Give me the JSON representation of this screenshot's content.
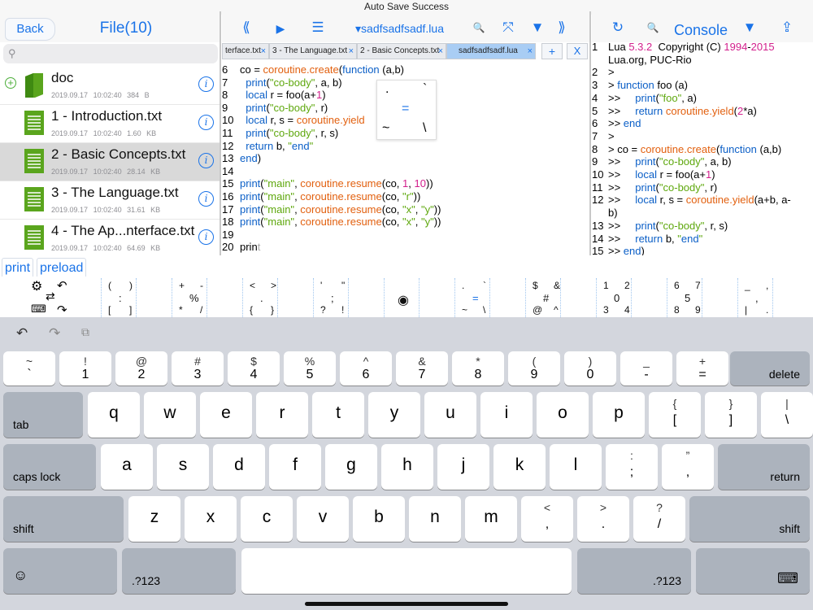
{
  "status": {
    "title": "Auto Save Success"
  },
  "files": {
    "back_label": "Back",
    "title": "File(10)",
    "search_placeholder": "",
    "items": [
      {
        "name": "doc",
        "date": "2019.09.17",
        "time": "10:02:40",
        "size": "384 B",
        "type": "folder"
      },
      {
        "name": "1 - Introduction.txt",
        "date": "2019.09.17",
        "time": "10:02:40",
        "size": "1.60 KB",
        "type": "file"
      },
      {
        "name": "2 - Basic Concepts.txt",
        "date": "2019.09.17",
        "time": "10:02:40",
        "size": "28.14 KB",
        "type": "file",
        "selected": true
      },
      {
        "name": "3 - The Language.txt",
        "date": "2019.09.17",
        "time": "10:02:40",
        "size": "31.61 KB",
        "type": "file"
      },
      {
        "name": "4 - The Ap...nterface.txt",
        "date": "2019.09.17",
        "time": "10:02:40",
        "size": "64.69 KB",
        "type": "file"
      }
    ],
    "info_glyph": "i"
  },
  "editor": {
    "toolbar": {
      "prev": "⟪",
      "run": "▶",
      "outline": "☰",
      "filename": "▾sadfsadfsadf.lua",
      "search": "🔍",
      "fullscreen": "⤧",
      "down": "▼",
      "next": "⟫"
    },
    "tabs": [
      {
        "label": "terface.txt"
      },
      {
        "label": "3 - The Language.txt"
      },
      {
        "label": "2 - Basic Concepts.txt"
      },
      {
        "label": "sadfsadfsadf.lua",
        "active": true
      }
    ],
    "tab_add": "+",
    "tab_close": "X",
    "tab_x": "×",
    "lines": [
      {
        "n": "6",
        "t": "co = coroutine.create(function (a,b)"
      },
      {
        "n": "7",
        "t": "  print(\"co-body\", a, b)"
      },
      {
        "n": "8",
        "t": "  local r = foo(a+1)"
      },
      {
        "n": "9",
        "t": "  print(\"co-body\", r)"
      },
      {
        "n": "10",
        "t": "  local r, s = coroutine.yield"
      },
      {
        "n": "11",
        "t": "  print(\"co-body\", r, s)"
      },
      {
        "n": "12",
        "t": "  return b, \"end\""
      },
      {
        "n": "13",
        "t": "end)"
      },
      {
        "n": "14",
        "t": ""
      },
      {
        "n": "15",
        "t": "print(\"main\", coroutine.resume(co, 1, 10))"
      },
      {
        "n": "16",
        "t": "print(\"main\", coroutine.resume(co, \"r\"))"
      },
      {
        "n": "17",
        "t": "print(\"main\", coroutine.resume(co, \"x\", \"y\"))"
      },
      {
        "n": "18",
        "t": "print(\"main\", coroutine.resume(co, \"x\", \"y\"))"
      },
      {
        "n": "19",
        "t": ""
      },
      {
        "n": "20",
        "t": "print"
      }
    ],
    "popup": {
      "tl": ".",
      "tr": "`",
      "c": "=",
      "bl": "~",
      "br": "\\"
    }
  },
  "console": {
    "refresh": "↻",
    "search": "🔍",
    "title": "Console",
    "down": "▼",
    "share": "⇪",
    "lines": [
      {
        "n": "1",
        "t": "Lua 5.3.2  Copyright (C) 1994-2015"
      },
      {
        "n": "",
        "t": "Lua.org, PUC-Rio"
      },
      {
        "n": "2",
        "t": ">"
      },
      {
        "n": "3",
        "t": "> function foo (a)"
      },
      {
        "n": "4",
        "t": ">>     print(\"foo\", a)"
      },
      {
        "n": "5",
        "t": ">>     return coroutine.yield(2*a)"
      },
      {
        "n": "6",
        "t": ">> end"
      },
      {
        "n": "7",
        "t": ">"
      },
      {
        "n": "8",
        "t": "> co = coroutine.create(function (a,b)"
      },
      {
        "n": "9",
        "t": ">>     print(\"co-body\", a, b)"
      },
      {
        "n": "10",
        "t": ">>     local r = foo(a+1)"
      },
      {
        "n": "11",
        "t": ">>     print(\"co-body\", r)"
      },
      {
        "n": "12",
        "t": ">>     local r, s = coroutine.yield(a+b, a-"
      },
      {
        "n": "",
        "t": "b)"
      },
      {
        "n": "13",
        "t": ">>     print(\"co-body\", r, s)"
      },
      {
        "n": "14",
        "t": ">>     return b, \"end\""
      },
      {
        "n": "15",
        "t": ">> end)"
      }
    ]
  },
  "quickbar": {
    "print": "print",
    "preload": "preload"
  },
  "symbols": [
    {
      "a": "(",
      "b": ")",
      "c": ":",
      "d": "[",
      "e": "]"
    },
    {
      "a": "+",
      "b": "-",
      "c": "%",
      "d": "*",
      "e": "/"
    },
    {
      "a": "<",
      "b": ">",
      "c": ".",
      "d": "{",
      "e": "}"
    },
    {
      "a": "'",
      "b": "\"",
      "c": ";",
      "d": "?",
      "e": "!"
    },
    {
      "a": "",
      "b": "",
      "c": "◉",
      "d": "",
      "e": ""
    },
    {
      "a": ".",
      "b": "`",
      "c": "=",
      "d": "~",
      "e": "\\"
    },
    {
      "a": "$",
      "b": "&",
      "c": "#",
      "d": "@",
      "e": "^"
    },
    {
      "a": "1",
      "b": "2",
      "c": "0",
      "d": "3",
      "e": "4"
    },
    {
      "a": "6",
      "b": "7",
      "c": "5",
      "d": "8",
      "e": "9"
    },
    {
      "a": "_",
      "b": ",",
      "c": ",",
      "d": "|",
      "e": "."
    }
  ],
  "keyboard": {
    "undo": "↶",
    "redo": "↷",
    "paste": "⧉",
    "row1": [
      {
        "u": "~",
        "d": "`"
      },
      {
        "u": "!",
        "d": "1"
      },
      {
        "u": "@",
        "d": "2"
      },
      {
        "u": "#",
        "d": "3"
      },
      {
        "u": "$",
        "d": "4"
      },
      {
        "u": "%",
        "d": "5"
      },
      {
        "u": "^",
        "d": "6"
      },
      {
        "u": "&",
        "d": "7"
      },
      {
        "u": "*",
        "d": "8"
      },
      {
        "u": "(",
        "d": "9"
      },
      {
        "u": ")",
        "d": "0"
      },
      {
        "u": "_",
        "d": "-"
      },
      {
        "u": "+",
        "d": "="
      }
    ],
    "delete": "delete",
    "tab": "tab",
    "row2": [
      "q",
      "w",
      "e",
      "r",
      "t",
      "y",
      "u",
      "i",
      "o",
      "p"
    ],
    "row2b": [
      {
        "u": "{",
        "d": "["
      },
      {
        "u": "}",
        "d": "]"
      },
      {
        "u": "|",
        "d": "\\"
      }
    ],
    "capslock": "caps lock",
    "row3": [
      "a",
      "s",
      "d",
      "f",
      "g",
      "h",
      "j",
      "k",
      "l"
    ],
    "row3b": [
      {
        "u": ":",
        "d": ";"
      },
      {
        "u": "”",
        "d": ","
      }
    ],
    "return": "return",
    "shift": "shift",
    "row4": [
      "z",
      "x",
      "c",
      "v",
      "b",
      "n",
      "m"
    ],
    "row4b": [
      {
        "u": "<",
        "d": ","
      },
      {
        "u": ">",
        "d": "."
      },
      {
        "u": "?",
        "d": "/"
      }
    ],
    "emoji": "☺",
    "numbers": ".?123",
    "hide": "⌨"
  }
}
